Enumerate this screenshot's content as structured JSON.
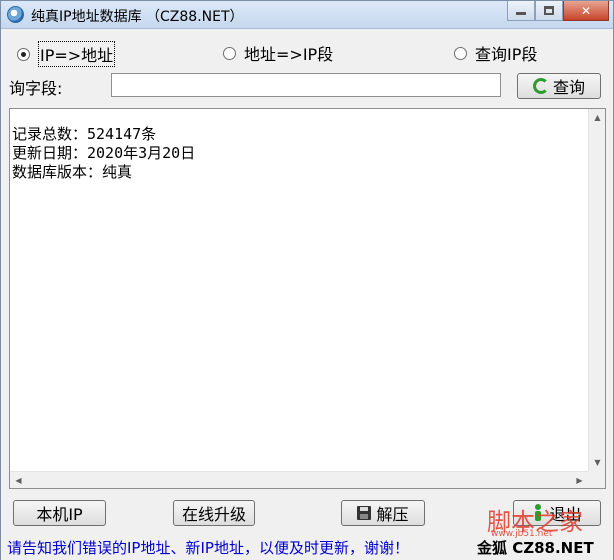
{
  "window": {
    "title": "纯真IP地址数据库 （CZ88.NET）",
    "close_glyph": "✕"
  },
  "modes": [
    {
      "label": "IP=>地址",
      "checked": true
    },
    {
      "label": "地址=>IP段",
      "checked": false
    },
    {
      "label": "查询IP段",
      "checked": false
    }
  ],
  "query": {
    "label": "询字段:",
    "value": "",
    "button_label": "查询"
  },
  "info": {
    "lines": [
      "记录总数：524147条",
      "更新日期：2020年3月20日",
      "数据库版本：纯真"
    ]
  },
  "buttons": {
    "local_ip": "本机IP",
    "online_upgrade": "在线升级",
    "unzip": "解压",
    "exit": "退出"
  },
  "status": {
    "message": "请告知我们错误的IP地址、新IP地址，以便及时更新，谢谢！",
    "brand": "金狐 CZ88.NET"
  },
  "watermark": {
    "text": "脚本之家",
    "sub": "www.jb51.net"
  },
  "colors": {
    "status_text": "#0000cc",
    "watermark": "#e23a2a",
    "refresh_icon": "#2e9b2e"
  }
}
